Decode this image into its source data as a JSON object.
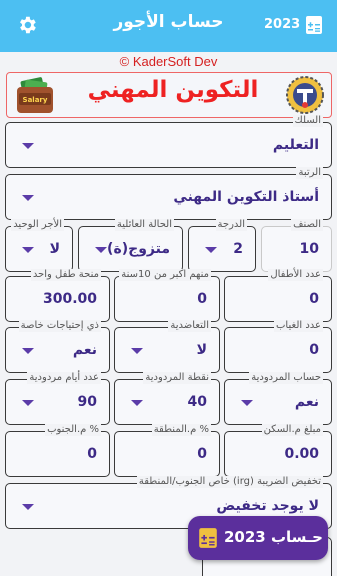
{
  "appbar": {
    "title": "حساب الأجور",
    "year": "2023",
    "settings_icon": "gear-icon",
    "calculator_icon": "calculator-icon"
  },
  "copyright": "© KaderSoft Dev",
  "banner": {
    "title": "التكوين المهني",
    "wallet_logo_text": "Salary",
    "accent_color": "#ee2222"
  },
  "fields": {
    "corps": {
      "label": "السلك",
      "value": "التعليم"
    },
    "grade": {
      "label": "الرتبة",
      "value": "أستاذ التكوين المهني"
    },
    "category": {
      "label": "الصنف",
      "value": "10"
    },
    "degree": {
      "label": "الدرجة",
      "value": "2"
    },
    "family": {
      "label": "الحالة العائلية",
      "value": "متزوج(ة)"
    },
    "single_wage": {
      "label": "الأجر الوحيد",
      "value": "لا"
    },
    "children": {
      "label": "عدد الأطفال",
      "value": "0"
    },
    "over10": {
      "label": "منهم اكبر من 10سنة",
      "value": "0"
    },
    "child_grant": {
      "label": "منحة طفل واحد",
      "value": "300.00"
    },
    "absence": {
      "label": "عدد الغياب",
      "value": "0"
    },
    "mutual": {
      "label": "التعاضدية",
      "value": "لا"
    },
    "special_needs": {
      "label": "ذي إحتياجات خاصة",
      "value": "نعم"
    },
    "perf_calc": {
      "label": "حساب المردودية",
      "value": "نعم"
    },
    "perf_points": {
      "label": "نقطة المردودية",
      "value": "40"
    },
    "perf_days": {
      "label": "عدد أيام مردودية",
      "value": "90"
    },
    "housing": {
      "label": "مبلغ م.السكن",
      "value": "0.00"
    },
    "zone": {
      "label": "% م.المنطقة",
      "value": "0"
    },
    "south": {
      "label": "% م.الجنوب",
      "value": "0"
    },
    "tax": {
      "label": "تخفيض الضريبة (irg) خاص الجنوب/المنطقة",
      "value": "لا يوجد تخفيض"
    }
  },
  "fab": {
    "label": "حـساب 2023",
    "bg": "#5b2f9c"
  },
  "colors": {
    "appbar": "#4cbff2",
    "value_text": "#3d2a86"
  }
}
